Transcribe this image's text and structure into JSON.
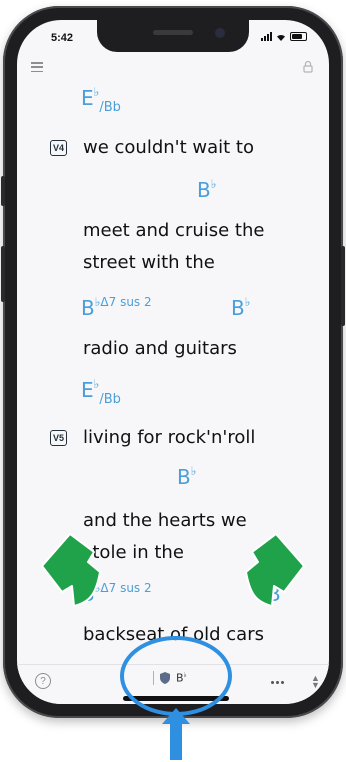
{
  "status_bar": {
    "time": "5:42"
  },
  "song": {
    "blocks": [
      {
        "chord": {
          "root": "E",
          "accidental": "b",
          "slash": "/Bb"
        }
      },
      {
        "verse": "V4",
        "lyric": "we couldn't wait to"
      },
      {
        "chord": {
          "root": "B",
          "accidental": "b"
        }
      },
      {
        "lyric": "meet and cruise the"
      },
      {
        "lyric": "street with the"
      },
      {
        "chord_a": {
          "root": "B",
          "accidental": "b",
          "ext": "Δ7 sus 2"
        },
        "chord_b": {
          "root": "B",
          "accidental": "b"
        }
      },
      {
        "lyric": "radio and guitars"
      },
      {
        "chord": {
          "root": "E",
          "accidental": "b",
          "slash": "/Bb"
        }
      },
      {
        "verse": "V5",
        "lyric": "living for rock'n'roll"
      },
      {
        "chord": {
          "root": "B",
          "accidental": "b"
        }
      },
      {
        "lyric": "and the hearts we"
      },
      {
        "lyric": "stole in the"
      },
      {
        "chord_a": {
          "root": "B",
          "accidental": "b",
          "ext": "Δ7 sus 2"
        },
        "chord_b": {
          "root": "B",
          "accidental": "b"
        }
      },
      {
        "lyric": "backseat of old cars"
      }
    ]
  },
  "bottom_bar": {
    "help_label": "?",
    "chip_key_root": "B",
    "chip_key_accidental": "b",
    "stepper_up": "▲",
    "stepper_down": "▼"
  },
  "colors": {
    "chord": "#4a9fd8",
    "annotation_green": "#1fa24a",
    "annotation_blue": "#2f8fe0"
  }
}
